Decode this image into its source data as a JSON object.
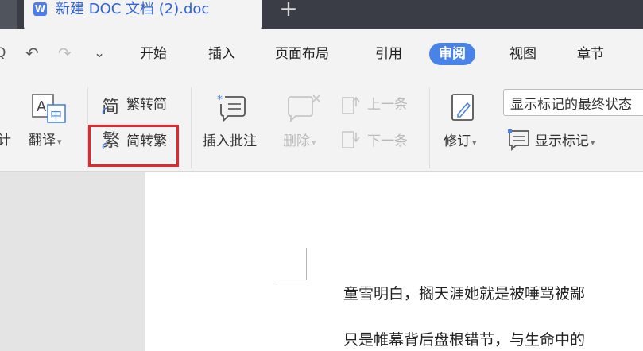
{
  "window": {
    "tab_title": "新建 DOC 文档 (2).doc",
    "tab_icon_letter": "W",
    "new_tab_glyph": "+"
  },
  "quick_access": {
    "preview_glyph": "Q",
    "undo_glyph": "↶",
    "redo_glyph": "↷",
    "more_glyph": "⌄"
  },
  "menu": {
    "items": [
      "开始",
      "插入",
      "页面布局",
      "引用",
      "审阅",
      "视图",
      "章节"
    ],
    "active": "审阅"
  },
  "ribbon": {
    "stats_partial": "计",
    "translate": "翻译",
    "trad_to_simp": "繁转简",
    "simp_to_trad": "简转繁",
    "insert_comment": "插入批注",
    "delete": "删除",
    "prev_item": "上一条",
    "next_item": "下一条",
    "revise": "修订",
    "display_mode": "显示标记的最终状态",
    "show_markup": "显示标记",
    "caret": "▾"
  },
  "document": {
    "lines": [
      "童雪明白，搁天涯她就是被唾骂被鄙",
      "只是帷幕背后盘根错节，与生命中的"
    ]
  },
  "colors": {
    "accent": "#4a83e8",
    "highlight": "#e0282e",
    "titlebar": "#3a3d45"
  }
}
